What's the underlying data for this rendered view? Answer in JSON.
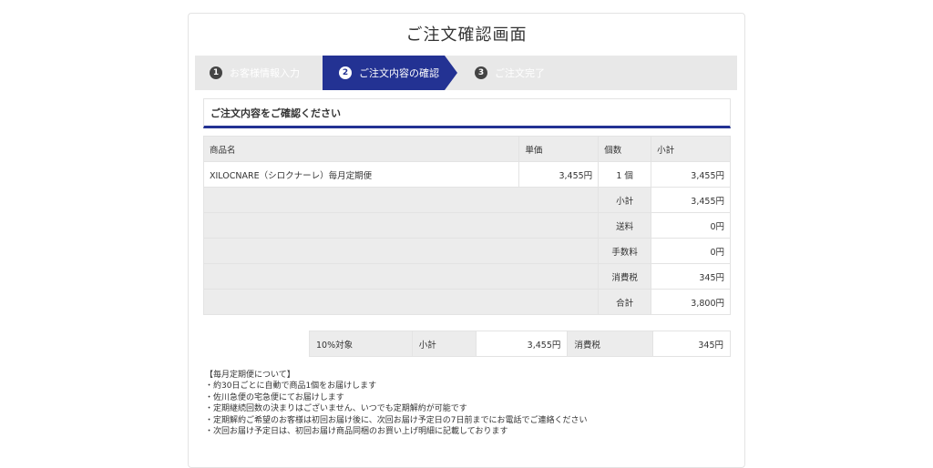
{
  "page_title": "ご注文確認画面",
  "steps": [
    {
      "num": "1",
      "label": "お客様情報入力",
      "state": "done"
    },
    {
      "num": "2",
      "label": "ご注文内容の確認",
      "state": "active"
    },
    {
      "num": "3",
      "label": "ご注文完了",
      "state": "pending"
    }
  ],
  "section_heading": "ご注文内容をご確認ください",
  "order_table": {
    "headers": [
      "商品名",
      "単価",
      "個数",
      "小計"
    ],
    "items": [
      {
        "name": "XILOCNARE（シロクナーレ）毎月定期便",
        "unit_price": "3,455円",
        "qty": "1 個",
        "subtotal": "3,455円"
      }
    ],
    "summary": [
      {
        "label": "小計",
        "value": "3,455円"
      },
      {
        "label": "送料",
        "value": "0円"
      },
      {
        "label": "手数料",
        "value": "0円"
      },
      {
        "label": "消費税",
        "value": "345円"
      },
      {
        "label": "合計",
        "value": "3,800円"
      }
    ]
  },
  "tax_table": {
    "target_label": "10%対象",
    "subtotal_label": "小計",
    "subtotal_value": "3,455円",
    "tax_label": "消費税",
    "tax_value": "345円"
  },
  "notes": [
    "【毎月定期便について】",
    "・約30日ごとに自動で商品1個をお届けします",
    "・佐川急便の宅急便にてお届けします",
    "・定期継続回数の決まりはございません、いつでも定期解約が可能です",
    "・定期解約ご希望のお客様は初回お届け後に、次回お届け予定日の7日前までにお電話でご連絡ください",
    "・次回お届け予定日は、初回お届け商品同梱のお買い上げ明細に記載しております"
  ]
}
